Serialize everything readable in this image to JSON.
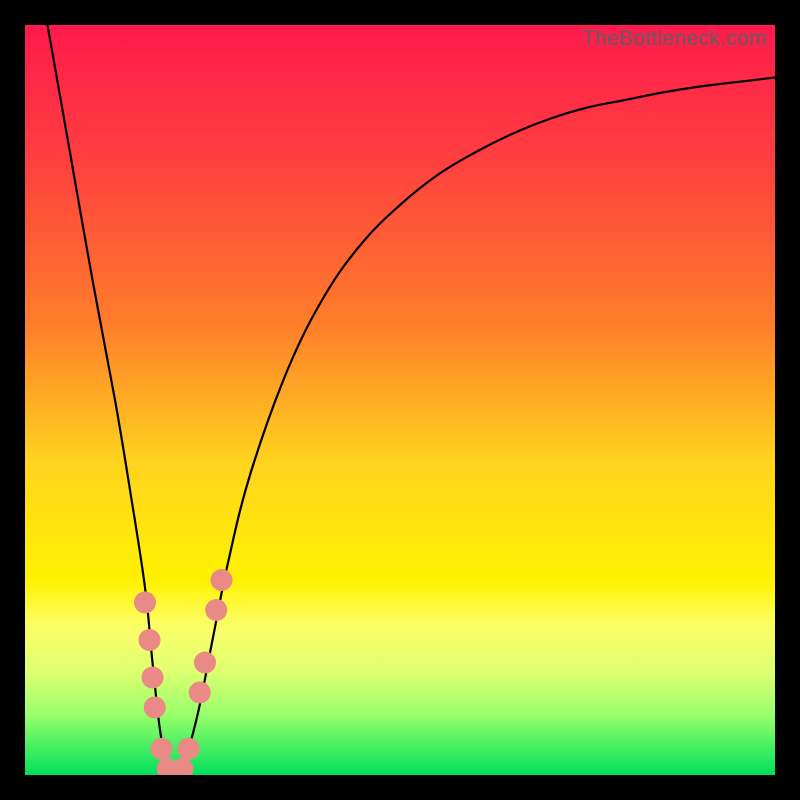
{
  "watermark": "TheBottleneck.com",
  "chart_data": {
    "type": "line",
    "title": "",
    "xlabel": "",
    "ylabel": "",
    "xlim": [
      0,
      100
    ],
    "ylim": [
      0,
      100
    ],
    "grid": false,
    "series": [
      {
        "name": "bottleneck-curve",
        "x": [
          3,
          6,
          9,
          12,
          14,
          16,
          17,
          18,
          19,
          20,
          21,
          23,
          25,
          27,
          30,
          35,
          40,
          45,
          50,
          55,
          60,
          65,
          70,
          75,
          80,
          85,
          90,
          95,
          100
        ],
        "y": [
          100,
          83,
          66,
          50,
          38,
          25,
          15,
          6,
          1,
          0,
          1,
          8,
          18,
          28,
          40,
          54,
          64,
          71,
          76,
          80,
          83,
          85.5,
          87.5,
          89,
          90,
          91,
          91.8,
          92.4,
          93
        ]
      }
    ],
    "markers": {
      "name": "highlight-beads",
      "color": "#e98a86",
      "points": [
        {
          "x": 16.0,
          "y": 23
        },
        {
          "x": 16.6,
          "y": 18
        },
        {
          "x": 17.0,
          "y": 13
        },
        {
          "x": 17.3,
          "y": 9
        },
        {
          "x": 18.2,
          "y": 3.5
        },
        {
          "x": 19.0,
          "y": 0.8
        },
        {
          "x": 19.5,
          "y": 0.3
        },
        {
          "x": 20.2,
          "y": 0.3
        },
        {
          "x": 21.0,
          "y": 0.8
        },
        {
          "x": 21.8,
          "y": 3.5
        },
        {
          "x": 23.3,
          "y": 11
        },
        {
          "x": 24.0,
          "y": 15
        },
        {
          "x": 25.5,
          "y": 22
        },
        {
          "x": 26.2,
          "y": 26
        }
      ]
    }
  }
}
